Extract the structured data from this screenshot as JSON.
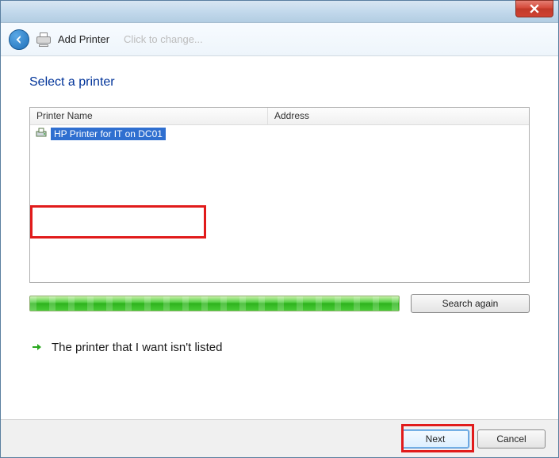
{
  "titlebar": {
    "close_tooltip": "Close"
  },
  "header": {
    "title": "Add Printer",
    "ghost": "Click to change..."
  },
  "main": {
    "heading": "Select a printer",
    "columns": {
      "name": "Printer Name",
      "address": "Address"
    },
    "rows": [
      {
        "name": "HP Printer for IT on DC01",
        "address": ""
      }
    ],
    "search_again": "Search again",
    "not_listed": "The printer that I want isn't listed"
  },
  "footer": {
    "next": "Next",
    "cancel": "Cancel"
  }
}
